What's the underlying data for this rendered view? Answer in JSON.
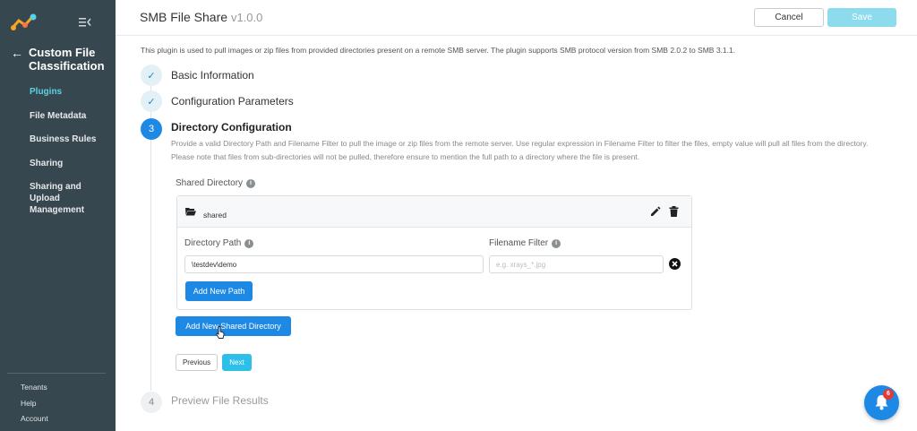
{
  "sidebar": {
    "app_title": "Custom File Classification",
    "items": [
      {
        "label": "Plugins",
        "active": true
      },
      {
        "label": "File Metadata",
        "active": false
      },
      {
        "label": "Business Rules",
        "active": false
      },
      {
        "label": "Sharing",
        "active": false
      },
      {
        "label": "Sharing and Upload Management",
        "active": false
      }
    ],
    "footer": [
      "Tenants",
      "Help",
      "Account"
    ]
  },
  "header": {
    "title": "SMB File Share",
    "version": "v1.0.0",
    "cancel_label": "Cancel",
    "save_label": "Save"
  },
  "description": "This plugin is used to pull images or zip files from provided directories present on a remote SMB server. The plugin supports SMB protocol version from SMB 2.0.2 to SMB 3.1.1.",
  "steps": [
    {
      "number": "1",
      "title": "Basic Information",
      "state": "done"
    },
    {
      "number": "2",
      "title": "Configuration Parameters",
      "state": "done"
    },
    {
      "number": "3",
      "title": "Directory Configuration",
      "state": "active"
    },
    {
      "number": "4",
      "title": "Preview File Results",
      "state": "pending"
    }
  ],
  "directory_config": {
    "description": "Provide a valid Directory Path and Filename Filter to pull the image or zip files from the remote server. Use regular expression in Filename Filter to filter the files, empty value will pull all files from the directory. Please note that files from sub-directories will not be pulled, therefore ensure to mention the full path to a directory where the file is present.",
    "shared_directory_label": "Shared Directory",
    "shared_name": "shared",
    "directory_path_label": "Directory Path",
    "filename_filter_label": "Filename Filter",
    "directory_path_value": "\\testdev\\demo",
    "filename_filter_placeholder": "e.g. xrays_*.jpg",
    "add_path_label": "Add New Path",
    "add_shared_dir_label": "Add New Shared Directory",
    "previous_label": "Previous",
    "next_label": "Next"
  },
  "notifications": {
    "count": "6"
  },
  "colors": {
    "sidebar_bg": "#37474f",
    "accent": "#1e88e5",
    "active_nav": "#5ad3e6"
  }
}
